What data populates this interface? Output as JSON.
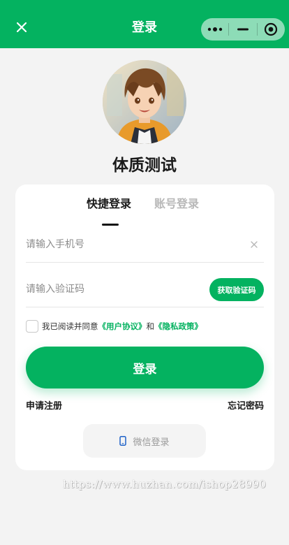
{
  "header": {
    "title": "登录",
    "close_icon": "close-icon",
    "capsule": {
      "more_icon": "more-dots-icon",
      "minimize_icon": "minimize-icon",
      "close_icon": "target-circle-icon"
    },
    "background_color": "#04b260"
  },
  "app": {
    "name": "体质测试",
    "avatar_icon": "anime-avatar"
  },
  "tabs": [
    {
      "label": "快捷登录",
      "active": true
    },
    {
      "label": "账号登录",
      "active": false
    }
  ],
  "form": {
    "phone": {
      "value": "",
      "placeholder": "请输入手机号"
    },
    "code": {
      "value": "",
      "placeholder": "请输入验证码"
    },
    "get_code_label": "获取验证码"
  },
  "agreement": {
    "prefix": "我已阅读并同意",
    "user_agreement": "《用户协议》",
    "and": "和",
    "privacy_policy": "《隐私政策》",
    "checked": false
  },
  "actions": {
    "login_label": "登录",
    "register_label": "申请注册",
    "forgot_label": "忘记密码",
    "wechat_login_label": "微信登录",
    "wechat_icon": "phone-icon"
  },
  "watermark": "https://www.huzhan.com/ishop28990",
  "accent_color": "#04b260"
}
